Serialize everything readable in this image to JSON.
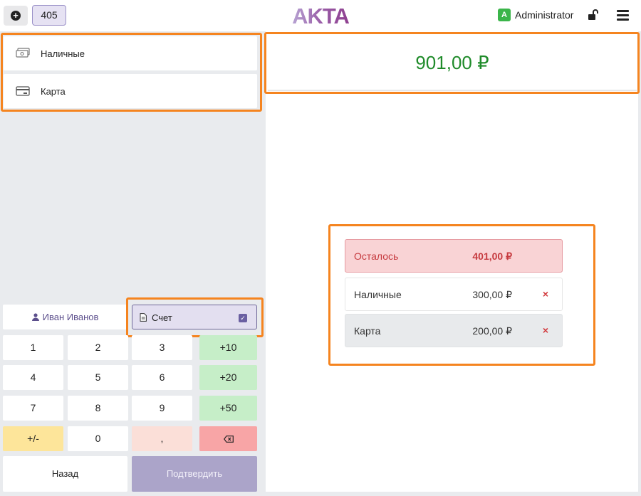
{
  "header": {
    "order_number": "405",
    "logo_text": "AKTA",
    "user_initial": "A",
    "user_name": "Administrator",
    "icons": [
      "plus-circle-icon",
      "lock-open-icon",
      "menu-icon"
    ]
  },
  "payment_methods": [
    {
      "label": "Наличные",
      "icon": "cash-icon"
    },
    {
      "label": "Карта",
      "icon": "card-icon"
    }
  ],
  "customer": {
    "name": "Иван Иванов",
    "icon": "person-icon"
  },
  "invoice": {
    "label": "Счет",
    "icon": "document-icon",
    "checked": true
  },
  "keypad": [
    [
      "1",
      "2",
      "3",
      "+10"
    ],
    [
      "4",
      "5",
      "6",
      "+20"
    ],
    [
      "7",
      "8",
      "9",
      "+50"
    ],
    [
      "+/-",
      "0",
      ",",
      "backspace-icon"
    ]
  ],
  "actions": {
    "back": "Назад",
    "confirm": "Подтвердить"
  },
  "total": "901,00 ₽",
  "summary": {
    "remaining_label": "Осталось",
    "remaining_value": "401,00 ₽",
    "payments": [
      {
        "label": "Наличные",
        "value": "300,00 ₽",
        "remove": "×"
      },
      {
        "label": "Карта",
        "value": "200,00 ₽",
        "remove": "×"
      }
    ]
  },
  "colors": {
    "accent": "#6a5fa1",
    "total_green": "#1f8b2a",
    "remaining_red": "#c63a3f",
    "highlight_orange": "#f5841f"
  }
}
